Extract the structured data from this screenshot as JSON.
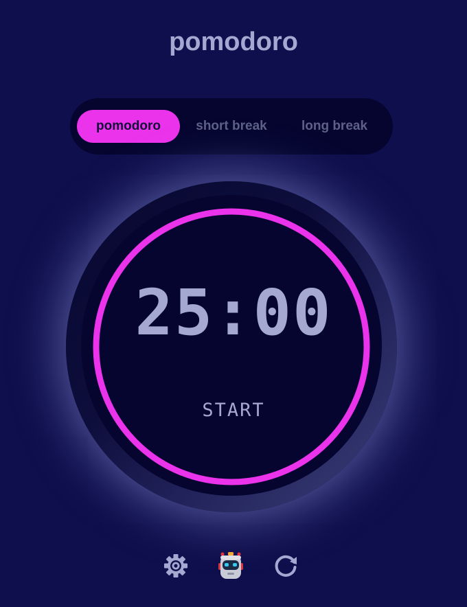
{
  "app": {
    "title": "pomodoro"
  },
  "modes": {
    "tabs": [
      {
        "label": "pomodoro",
        "active": true
      },
      {
        "label": "short break",
        "active": false
      },
      {
        "label": "long break",
        "active": false
      }
    ]
  },
  "timer": {
    "time": "25:00",
    "action_label": "START",
    "progress": 1.0
  },
  "toolbar": {
    "icons": [
      "settings-gear-icon",
      "robot-icon",
      "reset-icon"
    ]
  },
  "colors": {
    "background": "#0f0f4d",
    "accent": "#ec33ec",
    "text": "#a5a8d1",
    "dark_panel": "#050530"
  }
}
